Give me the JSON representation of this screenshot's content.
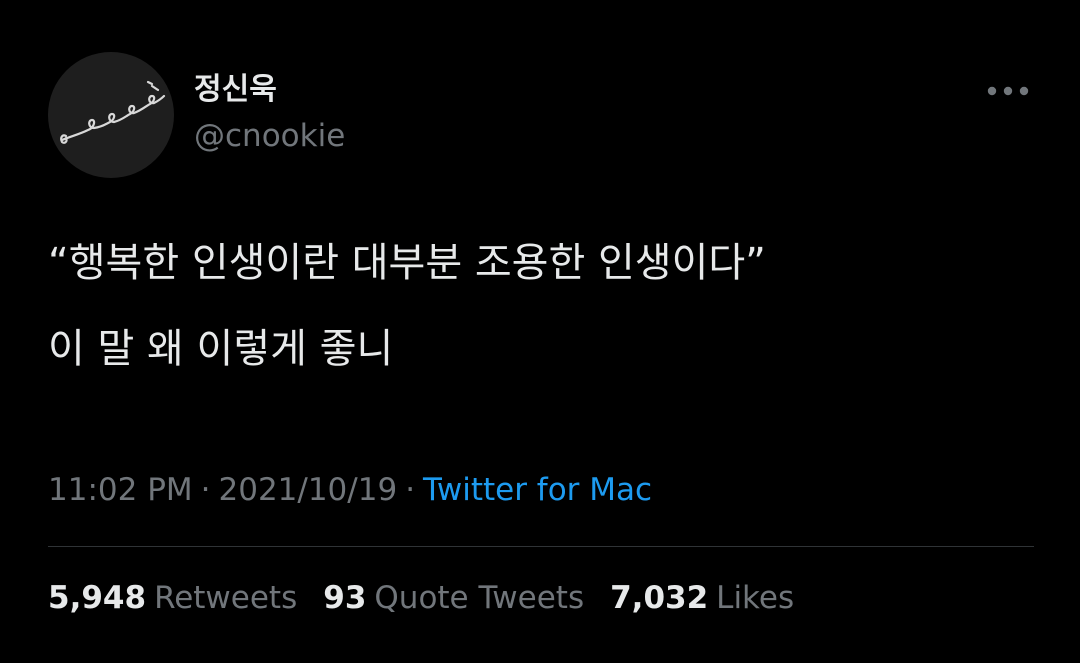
{
  "author": {
    "display_name": "정신욱",
    "handle": "@cnookie"
  },
  "tweet": {
    "lines": [
      "“행복한 인생이란 대부분 조용한 인생이다”",
      "이 말 왜 이렇게 좋니"
    ]
  },
  "meta": {
    "time": "11:02 PM",
    "separator": "·",
    "date": "2021/10/19",
    "source": "Twitter for Mac"
  },
  "stats": [
    {
      "count": "5,948",
      "label": "Retweets"
    },
    {
      "count": "93",
      "label": "Quote Tweets"
    },
    {
      "count": "7,032",
      "label": "Likes"
    }
  ],
  "icons": {
    "more": "more-horizontal-icon",
    "avatar": "string-lights-doodle"
  },
  "colors": {
    "background": "#000000",
    "primary_text": "#e7e9ea",
    "secondary_text": "#71767b",
    "link": "#1d9bf0",
    "divider": "#2f3336",
    "avatar_bg": "#1e1e1e"
  }
}
